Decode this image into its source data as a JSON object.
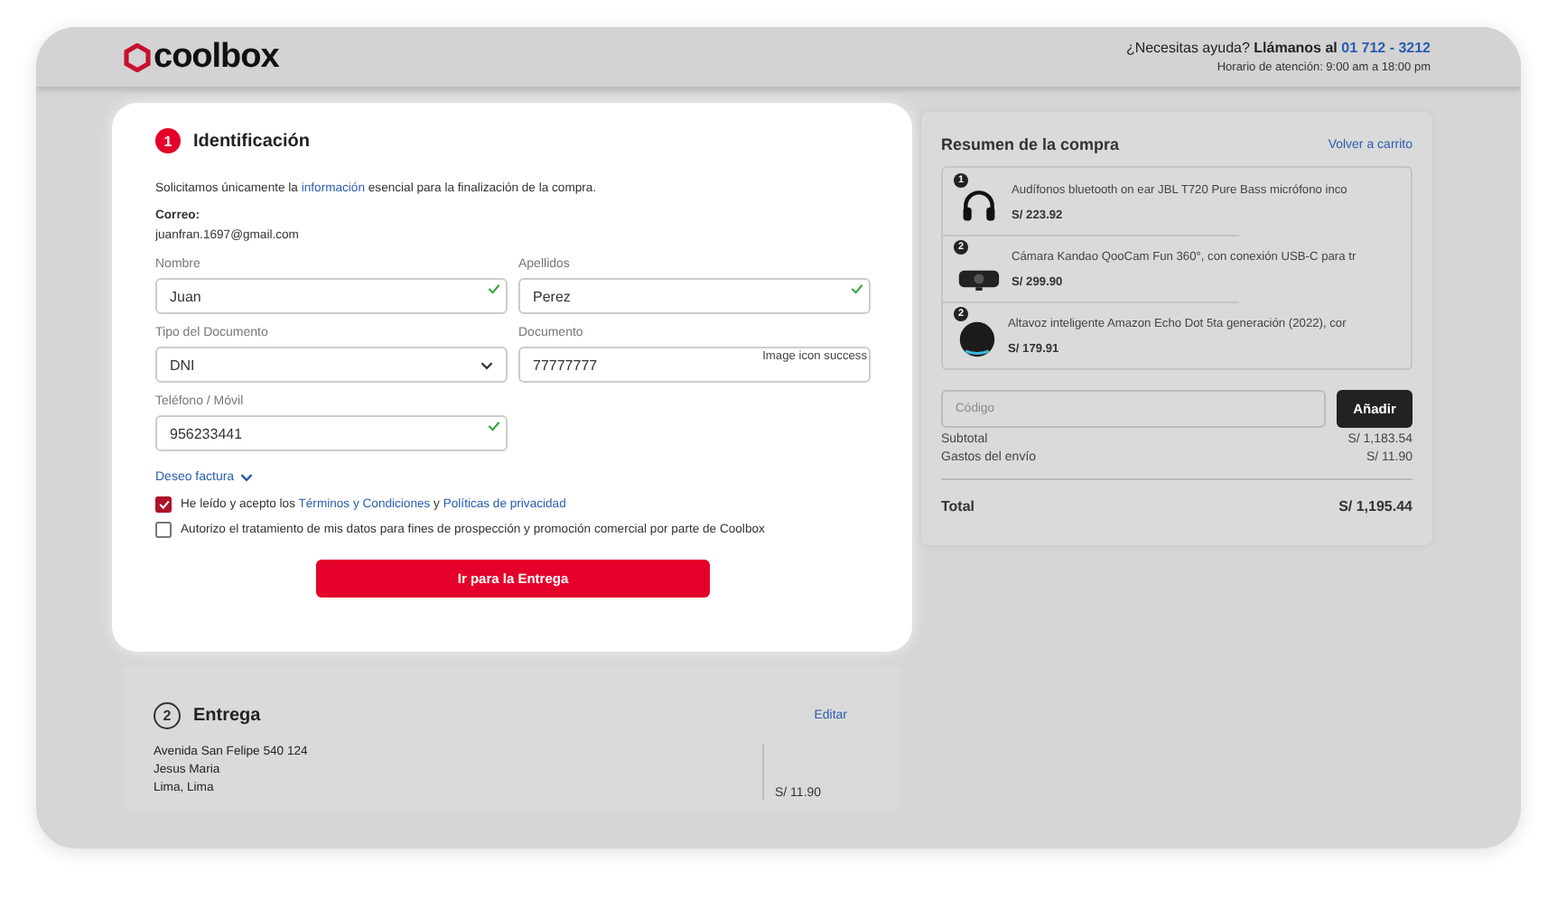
{
  "header": {
    "logo": "coolbox",
    "help_prefix": "¿Necesitas ayuda?",
    "help_call": "Llámanos al",
    "phone": "01 712 - 3212",
    "hours": "Horario de atención: 9:00 am a 18:00 pm"
  },
  "identification": {
    "step": "1",
    "title": "Identificación",
    "intro_before": "Solicitamos únicamente la",
    "intro_link": "información",
    "intro_after": "esencial para la finalización de la compra.",
    "email_label": "Correo:",
    "email": "juanfran.1697@gmail.com",
    "fields": [
      {
        "kind": "text",
        "label": "Nombre",
        "value": "Juan",
        "valid": true
      },
      {
        "kind": "text",
        "label": "Apellidos",
        "value": "Perez",
        "valid": true
      },
      {
        "kind": "select",
        "label": "Tipo del Documento",
        "value": "DNI"
      },
      {
        "kind": "text",
        "label": "Documento",
        "value": "77777777",
        "valid": false,
        "broken_image_alt": "Image icon success"
      },
      {
        "kind": "text",
        "label": "Teléfono / Móvil",
        "value": "956233441",
        "valid": true
      }
    ],
    "invoice_toggle": {
      "label": "Deseo factura",
      "expanded": false
    },
    "consents": [
      {
        "checked": true,
        "text": "He leído y acepto los",
        "link_1": "Términos y Condiciones",
        "joiner": "y",
        "link_2": "Políticas de privacidad"
      },
      {
        "checked": false,
        "text": "Autorizo el tratamiento de mis datos para fines de prospección y promoción comercial por parte de Coolbox"
      }
    ],
    "submit": "Ir para la Entrega"
  },
  "summary": {
    "title": "Resumen de la compra",
    "back_link": "Volver a carrito",
    "items": [
      {
        "kind": "headphones",
        "quantity": "1",
        "name": "Audífonos bluetooth on ear JBL T720 Pure Bass micrófono inco",
        "price": "S/ 223.92"
      },
      {
        "kind": "camera",
        "quantity": "2",
        "name": "Cámara Kandao QooCam Fun 360°, con conexión USB-C para tr",
        "price": "S/ 299.90"
      },
      {
        "kind": "speaker",
        "quantity": "2",
        "name": "Altavoz inteligente Amazon Echo Dot 5ta generación (2022), cor",
        "price": "S/ 179.91"
      }
    ],
    "coupon_placeholder": "Código",
    "apply": "Añadir",
    "lines": [
      {
        "label": "Subtotal",
        "value": "S/ 1,183.54"
      },
      {
        "label": "Gastos del envío",
        "value": "S/ 11.90"
      }
    ],
    "total_label": "Total",
    "total": "S/ 1,195.44"
  },
  "delivery": {
    "step": "2",
    "title": "Entrega",
    "edit": "Editar",
    "address_lines": [
      "Avenida San Felipe 540 124",
      "Jesus Maria",
      "Lima, Lima"
    ],
    "cost": "S/ 11.90"
  }
}
